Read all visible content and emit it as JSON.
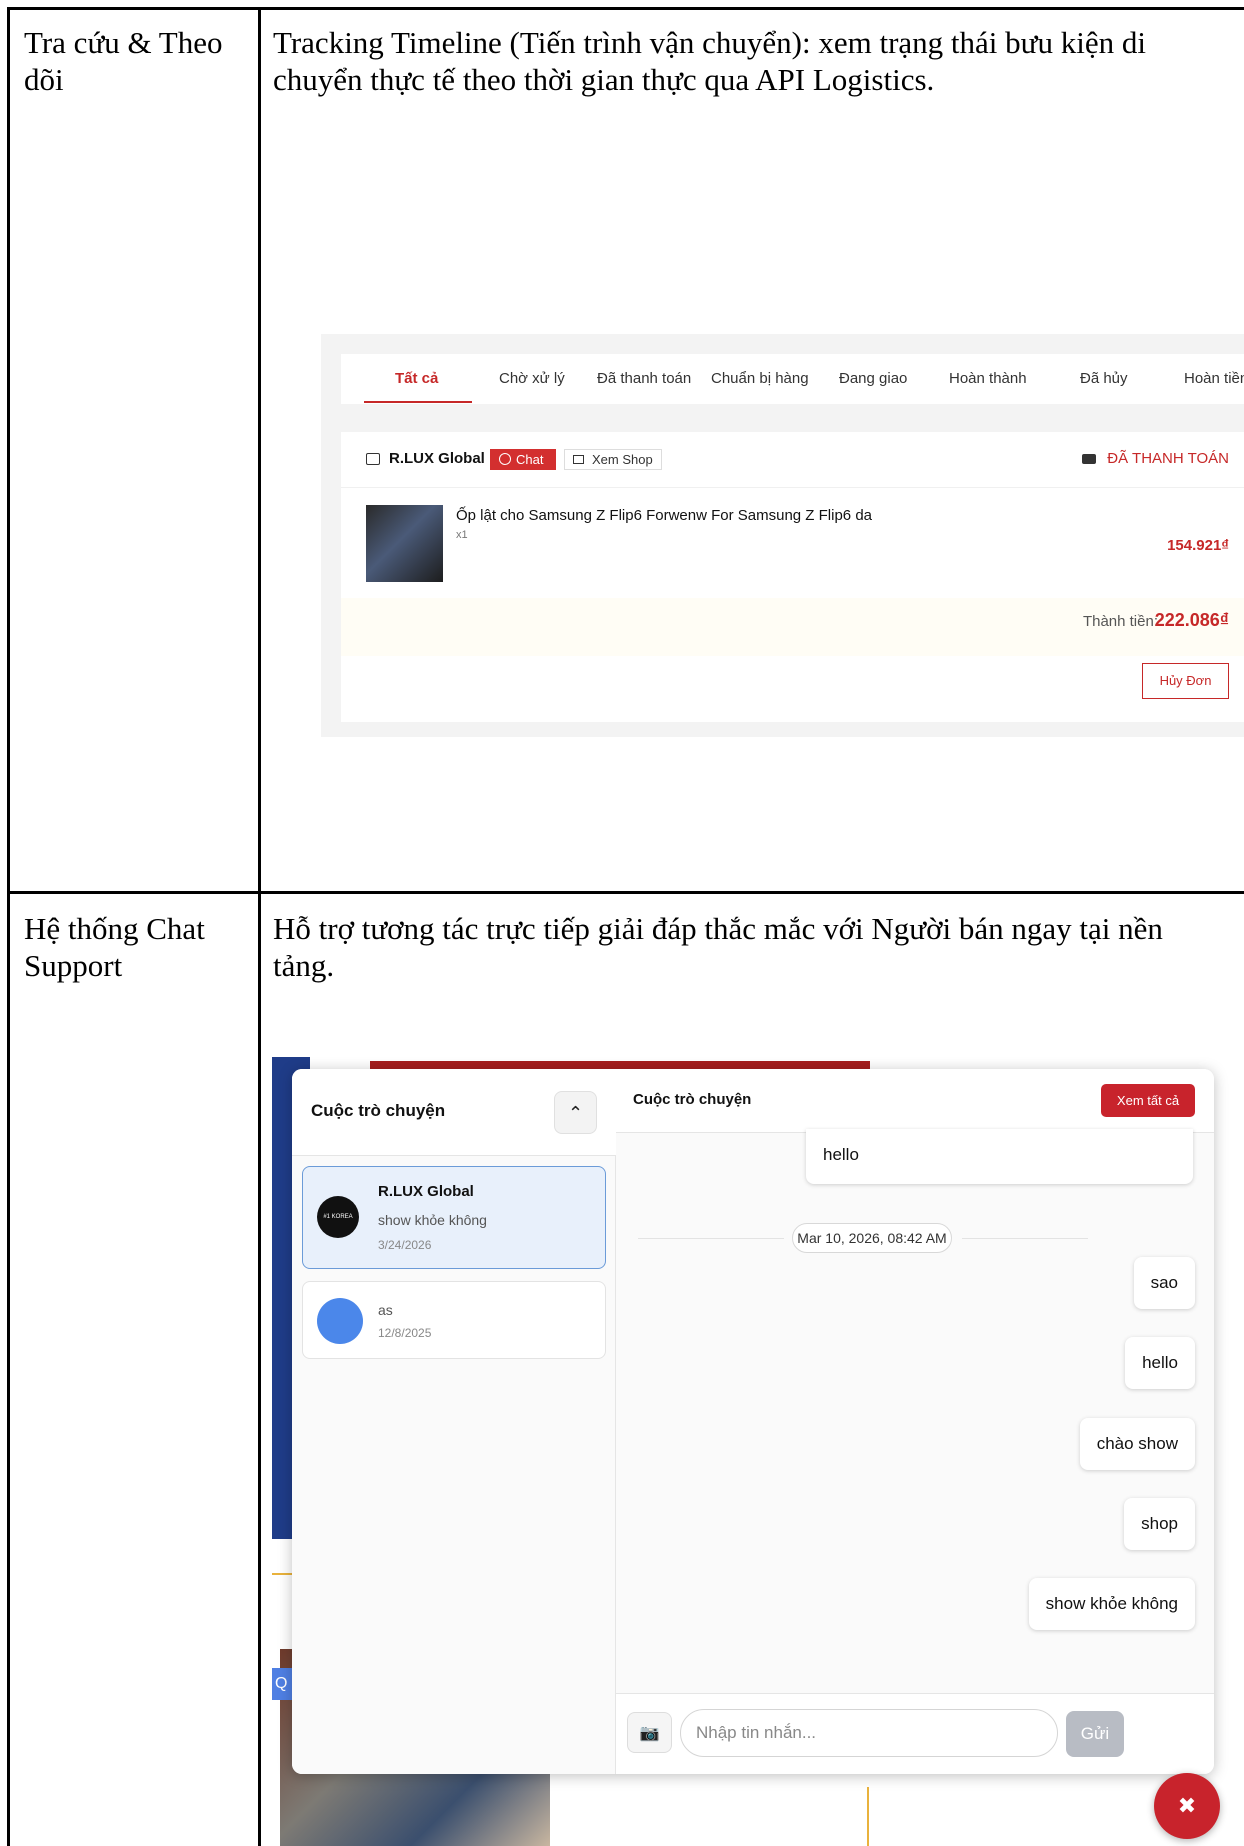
{
  "rows": [
    {
      "feature": "Tra cứu & Theo dõi",
      "description": "Tracking Timeline (Tiến trình vận chuyển): xem trạng thái bưu kiện di chuyển thực tế theo thời gian thực qua API Logistics."
    },
    {
      "feature": "Hệ thống Chat Support",
      "description": "Hỗ trợ tương tác trực tiếp giải đáp thắc mắc với Người bán ngay tại nền tảng."
    }
  ],
  "orders": {
    "tabs": [
      "Tất cả",
      "Chờ xử lý",
      "Đã thanh toán",
      "Chuẩn bị hàng",
      "Đang giao",
      "Hoàn thành",
      "Đã hủy",
      "Hoàn tiền"
    ],
    "active_tab": "Tất cả",
    "shop_name": "R.LUX Global",
    "chat_label": "Chat",
    "view_shop_label": "Xem Shop",
    "status": "ĐÃ THANH TOÁN",
    "product_name": "Ốp lật cho Samsung Z Flip6 Forwenw For Samsung Z Flip6 da",
    "quantity": "x1",
    "price": "154.921₫",
    "total_label": "Thành tiền:",
    "total_value": "222.086₫",
    "cancel_label": "Hủy Đơn"
  },
  "chat": {
    "list_title": "Cuộc trò chuyện",
    "conversations": [
      {
        "name": "R.LUX Global",
        "last_message": "show khỏe không",
        "date": "3/24/2026",
        "avatar_text": "#1 KOREA"
      },
      {
        "name": "",
        "last_message": "as",
        "date": "12/8/2025"
      }
    ],
    "thread_title": "Cuộc trò chuyện",
    "view_all_label": "Xem tất cả",
    "incoming_message": "hello",
    "date_separator": "Mar 10, 2026, 08:42 AM",
    "outgoing_messages": [
      "sao",
      "hello",
      "chào show",
      "shop",
      "show khỏe không"
    ],
    "input_placeholder": "Nhập tin nhắn...",
    "send_label": "Gửi",
    "background_tag": "Q"
  },
  "colors": {
    "accent_red": "#c62828",
    "button_red": "#c8232c",
    "active_conv_bg": "#e8f0fb"
  }
}
